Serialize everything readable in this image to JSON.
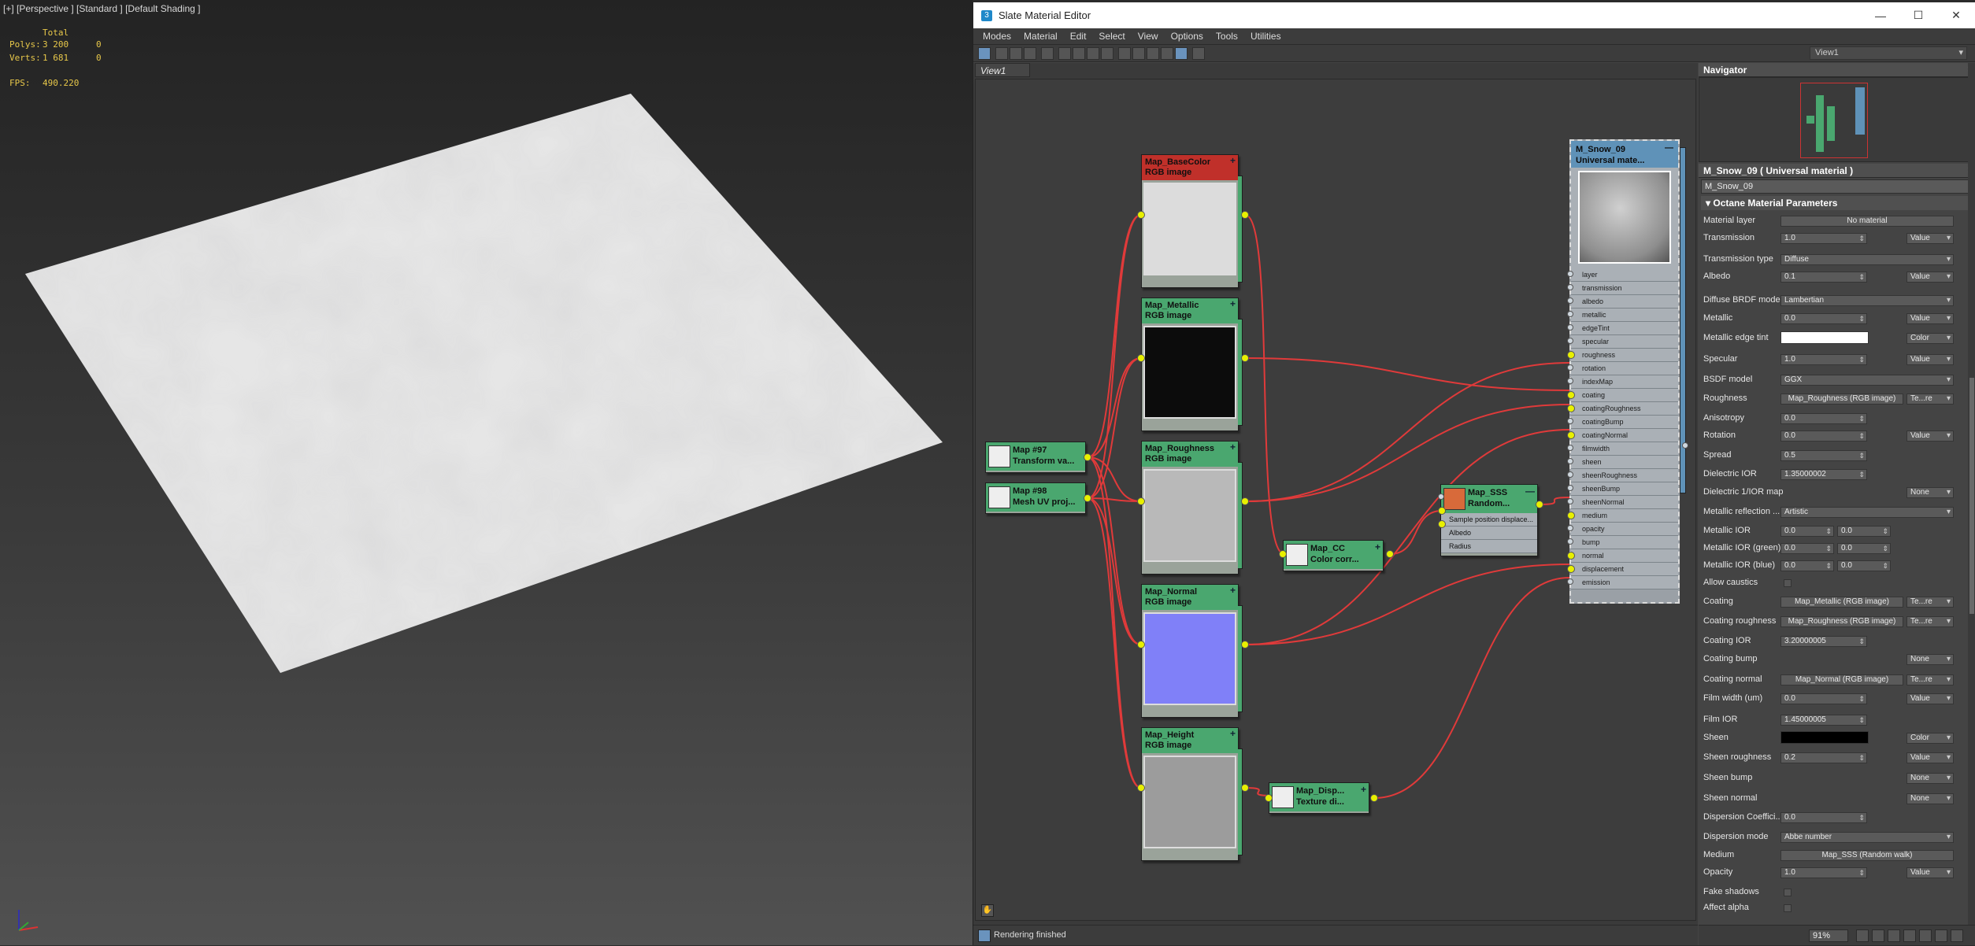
{
  "viewport": {
    "label": "[+] [Perspective ] [Standard ] [Default Shading ]",
    "stats": {
      "total_header": "Total",
      "polys_label": "Polys:",
      "polys_total": "3 200",
      "polys_sel": "0",
      "verts_label": "Verts:",
      "verts_total": "1 681",
      "verts_sel": "0",
      "fps_label": "FPS:",
      "fps_value": "490.220"
    }
  },
  "editor": {
    "title": "Slate Material Editor",
    "app_icon": "3",
    "window_buttons": {
      "minimize": "—",
      "maximize": "☐",
      "close": "✕"
    },
    "menu": [
      "Modes",
      "Material",
      "Edit",
      "Select",
      "View",
      "Options",
      "Tools",
      "Utilities"
    ],
    "view_dropdown": "View1",
    "view_tab": "View1",
    "status": "Rendering finished",
    "zoom": "91%"
  },
  "nodes": {
    "base_color": {
      "title": "Map_BaseColor",
      "subtitle": "RGB image"
    },
    "metallic": {
      "title": "Map_Metallic",
      "subtitle": "RGB image"
    },
    "roughness": {
      "title": "Map_Roughness",
      "subtitle": "RGB image"
    },
    "normal": {
      "title": "Map_Normal",
      "subtitle": "RGB image"
    },
    "height": {
      "title": "Map_Height",
      "subtitle": "RGB image"
    },
    "map97": {
      "title": "Map #97",
      "subtitle": "Transform va..."
    },
    "map98": {
      "title": "Map #98",
      "subtitle": "Mesh UV proj..."
    },
    "cc": {
      "title": "Map_CC",
      "subtitle": "Color corr..."
    },
    "disp": {
      "title": "Map_Disp...",
      "subtitle": "Texture di..."
    },
    "sss": {
      "title": "Map_SSS",
      "subtitle": "Random...",
      "sockets": [
        "Sample position displace...",
        "Albedo",
        "Radius"
      ]
    },
    "material": {
      "title": "M_Snow_09",
      "subtitle": "Universal mate...",
      "sockets": [
        "layer",
        "transmission",
        "albedo",
        "metallic",
        "edgeTint",
        "specular",
        "roughness",
        "rotation",
        "indexMap",
        "coating",
        "coatingRoughness",
        "coatingBump",
        "coatingNormal",
        "filmwidth",
        "sheen",
        "sheenRoughness",
        "sheenBump",
        "sheenNormal",
        "medium",
        "opacity",
        "bump",
        "normal",
        "displacement",
        "emission"
      ]
    }
  },
  "navigator": {
    "title": "Navigator",
    "close": "×"
  },
  "params": {
    "header": "M_Snow_09  ( Universal material )",
    "name_field": "M_Snow_09",
    "rollout": "Octane Material Parameters",
    "rows": {
      "material_layer": {
        "label": "Material layer",
        "value": "No material"
      },
      "transmission": {
        "label": "Transmission",
        "value": "1.0",
        "mode": "Value"
      },
      "transmission_type": {
        "label": "Transmission type",
        "value": "Diffuse"
      },
      "albedo": {
        "label": "Albedo",
        "value": "0.1",
        "mode": "Value"
      },
      "diffuse_brdf": {
        "label": "Diffuse BRDF model",
        "value": "Lambertian"
      },
      "metallic": {
        "label": "Metallic",
        "value": "0.0",
        "mode": "Value"
      },
      "edge_tint": {
        "label": "Metallic edge tint",
        "mode": "Color"
      },
      "specular": {
        "label": "Specular",
        "value": "1.0",
        "mode": "Value"
      },
      "bsdf": {
        "label": "BSDF model",
        "value": "GGX"
      },
      "roughness": {
        "label": "Roughness",
        "value": "Map_Roughness (RGB image)",
        "mode": "Te...re"
      },
      "anisotropy": {
        "label": "Anisotropy",
        "value": "0.0"
      },
      "rotation": {
        "label": "Rotation",
        "value": "0.0",
        "mode": "Value"
      },
      "spread": {
        "label": "Spread",
        "value": "0.5"
      },
      "dielectric_ior": {
        "label": "Dielectric IOR",
        "value": "1.35000002"
      },
      "dielectric_map": {
        "label": "Dielectric 1/IOR map",
        "mode": "None"
      },
      "metal_reflection": {
        "label": "Metallic reflection ...",
        "value": "Artistic"
      },
      "metal_ior": {
        "label": "Metallic IOR",
        "a": "0.0",
        "b": "0.0"
      },
      "metal_ior_green": {
        "label": "Metallic IOR (green)",
        "a": "0.0",
        "b": "0.0"
      },
      "metal_ior_blue": {
        "label": "Metallic IOR (blue)",
        "a": "0.0",
        "b": "0.0"
      },
      "caustics": {
        "label": "Allow caustics"
      },
      "coating": {
        "label": "Coating",
        "value": "Map_Metallic (RGB image)",
        "mode": "Te...re"
      },
      "coating_roughness": {
        "label": "Coating roughness",
        "value": "Map_Roughness (RGB image)",
        "mode": "Te...re"
      },
      "coating_ior": {
        "label": "Coating IOR",
        "value": "3.20000005"
      },
      "coating_bump": {
        "label": "Coating bump",
        "mode": "None"
      },
      "coating_normal": {
        "label": "Coating normal",
        "value": "Map_Normal (RGB image)",
        "mode": "Te...re"
      },
      "film_width": {
        "label": "Film width (um)",
        "value": "0.0",
        "mode": "Value"
      },
      "film_ior": {
        "label": "Film IOR",
        "value": "1.45000005"
      },
      "sheen": {
        "label": "Sheen",
        "mode": "Color"
      },
      "sheen_roughness": {
        "label": "Sheen roughness",
        "value": "0.2",
        "mode": "Value"
      },
      "sheen_bump": {
        "label": "Sheen bump",
        "mode": "None"
      },
      "sheen_normal": {
        "label": "Sheen normal",
        "mode": "None"
      },
      "dispersion_coef": {
        "label": "Dispersion Coeffici...",
        "value": "0.0"
      },
      "dispersion_mode": {
        "label": "Dispersion mode",
        "value": "Abbe number"
      },
      "medium": {
        "label": "Medium",
        "value": "Map_SSS (Random walk)"
      },
      "opacity": {
        "label": "Opacity",
        "value": "1.0",
        "mode": "Value"
      },
      "fake_shadows": {
        "label": "Fake shadows"
      },
      "affect_alpha": {
        "label": "Affect alpha"
      }
    }
  },
  "colors": {
    "node_header": "#4aa76f",
    "material_header": "#5f92b8",
    "wire": "#e03a3a",
    "port": "#e8f000",
    "stats": "#e8c84a"
  }
}
